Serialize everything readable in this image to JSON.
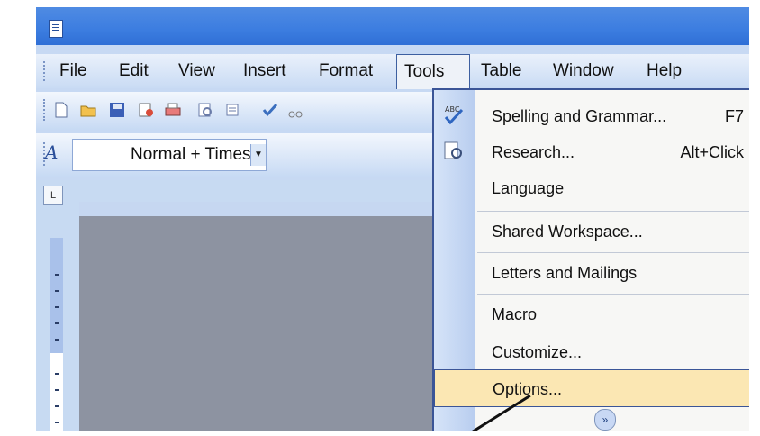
{
  "menubar": {
    "items": [
      "File",
      "Edit",
      "View",
      "Insert",
      "Format",
      "Tools",
      "Table",
      "Window",
      "Help"
    ],
    "active": "Tools"
  },
  "formatting": {
    "style_value": "Normal + Times"
  },
  "tools_menu": {
    "items": [
      {
        "label": "Spelling and Grammar...",
        "shortcut": "F7",
        "icon": "spelling-grammar-icon"
      },
      {
        "label": "Research...",
        "shortcut": "Alt+Click",
        "icon": "research-icon"
      },
      {
        "label": "Language",
        "submenu": true
      },
      {
        "label": "Shared Workspace..."
      },
      {
        "label": "Letters and Mailings",
        "submenu": true
      },
      {
        "label": "Macro",
        "submenu": true
      },
      {
        "label": "Customize..."
      },
      {
        "label": "Options...",
        "highlighted": true
      }
    ],
    "expand_glyph": "»"
  },
  "colors": {
    "titlebar": "#3c7de0",
    "menu_highlight": "#fbe7b3",
    "menu_border": "#3b5597"
  }
}
